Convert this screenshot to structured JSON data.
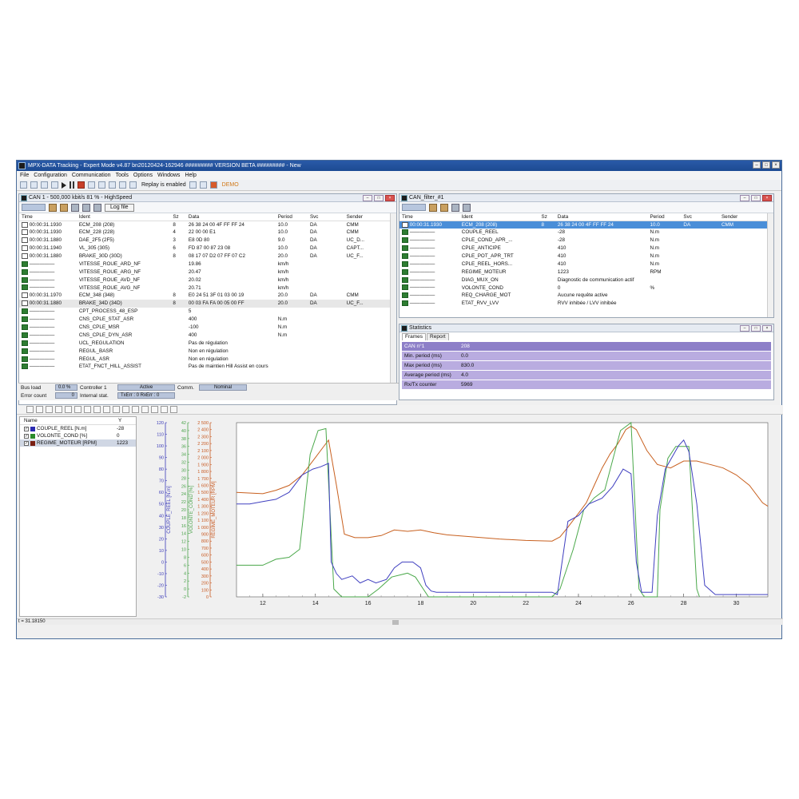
{
  "window": {
    "title": "MPX-DATA Tracking - Expert Mode v4.87 bn20120424-162946 ######### VERSION BETA ######### - New"
  },
  "menu": [
    "File",
    "Configuration",
    "Communication",
    "Tools",
    "Options",
    "Windows",
    "Help"
  ],
  "toolbar": {
    "replay_label": "Replay is enabled",
    "demo_label": "DEMO"
  },
  "can1": {
    "title": "CAN 1 - 500,000 kbit/s 81 % - HighSpeed",
    "log_button": "Log file",
    "columns": [
      "Time",
      "Ident",
      "Sz",
      "Data",
      "Period",
      "Svc",
      "Sender"
    ],
    "rows": [
      {
        "icon": "t",
        "time": "00:00:31.1930",
        "ident": "ECM_208 (208)",
        "sz": "8",
        "data": "26 38 24 00 4F FF FF 24",
        "period": "10.0",
        "svc": "DA",
        "sender": "CMM"
      },
      {
        "icon": "t",
        "time": "00:00:31.1930",
        "ident": "ECM_228 (228)",
        "sz": "4",
        "data": "22 00 00 E1",
        "period": "10.0",
        "svc": "DA",
        "sender": "CMM"
      },
      {
        "icon": "t",
        "time": "00:00:31.1880",
        "ident": "DAE_2F5 (2F5)",
        "sz": "3",
        "data": "E8 0D 80",
        "period": "9.0",
        "svc": "DA",
        "sender": "UC_D..."
      },
      {
        "icon": "t",
        "time": "00:00:31.1940",
        "ident": "VL_305 (305)",
        "sz": "6",
        "data": "FD 87 00 87 23 08",
        "period": "10.0",
        "svc": "DA",
        "sender": "CAPT..."
      },
      {
        "icon": "t",
        "time": "00:00:31.1880",
        "ident": "BRAKE_30D (30D)",
        "sz": "8",
        "data": "08 17 07 D2 07 FF 07 C2",
        "period": "20.0",
        "svc": "DA",
        "sender": "UC_F..."
      },
      {
        "icon": "g",
        "time": "—————",
        "ident": "VITESSE_ROUE_ARD_NF",
        "sz": "",
        "data": "19.86",
        "period": "km/h",
        "svc": "",
        "sender": ""
      },
      {
        "icon": "g",
        "time": "—————",
        "ident": "VITESSE_ROUE_ARG_NF",
        "sz": "",
        "data": "20.47",
        "period": "km/h",
        "svc": "",
        "sender": ""
      },
      {
        "icon": "g",
        "time": "—————",
        "ident": "VITESSE_ROUE_AVD_NF",
        "sz": "",
        "data": "20.02",
        "period": "km/h",
        "svc": "",
        "sender": ""
      },
      {
        "icon": "g",
        "time": "—————",
        "ident": "VITESSE_ROUE_AVG_NF",
        "sz": "",
        "data": "20.71",
        "period": "km/h",
        "svc": "",
        "sender": ""
      },
      {
        "icon": "t",
        "time": "00:00:31.1970",
        "ident": "ECM_348 (348)",
        "sz": "8",
        "data": "E0 24 51 3F 01 03 00 19",
        "period": "20.0",
        "svc": "DA",
        "sender": "CMM"
      },
      {
        "icon": "t",
        "time": "00:00:31.1880",
        "ident": "BRAKE_34D (34D)",
        "sz": "8",
        "data": "00 03 FA FA 00 05 00 FF",
        "period": "20.0",
        "svc": "DA",
        "sender": "UC_F...",
        "grey": true
      },
      {
        "icon": "g",
        "time": "—————",
        "ident": "CPT_PROCESS_48_ESP",
        "sz": "",
        "data": "5",
        "period": "",
        "svc": "",
        "sender": ""
      },
      {
        "icon": "g",
        "time": "—————",
        "ident": "CNS_CPLE_STAT_ASR",
        "sz": "",
        "data": "400",
        "period": "N.m",
        "svc": "",
        "sender": ""
      },
      {
        "icon": "g",
        "time": "—————",
        "ident": "CNS_CPLE_MSR",
        "sz": "",
        "data": "-100",
        "period": "N.m",
        "svc": "",
        "sender": ""
      },
      {
        "icon": "g",
        "time": "—————",
        "ident": "CNS_CPLE_DYN_ASR",
        "sz": "",
        "data": "400",
        "period": "N.m",
        "svc": "",
        "sender": ""
      },
      {
        "icon": "g",
        "time": "—————",
        "ident": "UCL_REGULATION",
        "sz": "",
        "data": "Pas de régulation",
        "period": "",
        "svc": "",
        "sender": ""
      },
      {
        "icon": "g",
        "time": "—————",
        "ident": "REGUL_BASR",
        "sz": "",
        "data": "Non en régulation",
        "period": "",
        "svc": "",
        "sender": ""
      },
      {
        "icon": "g",
        "time": "—————",
        "ident": "REGUL_ASR",
        "sz": "",
        "data": "Non en régulation",
        "period": "",
        "svc": "",
        "sender": ""
      },
      {
        "icon": "g",
        "time": "—————",
        "ident": "ETAT_FNCT_HILL_ASSIST",
        "sz": "",
        "data": "Pas de maintien Hill Assist en cours",
        "period": "",
        "svc": "",
        "sender": ""
      }
    ],
    "status": {
      "bus_load_label": "Bus load",
      "bus_load": "0.0 %",
      "controller_label": "Controller 1",
      "controller_state": "Active",
      "comm_label": "Comm.",
      "comm_state": "Nominal",
      "error_count_label": "Error count",
      "error_count": "0",
      "internal_label": "Internal stat.",
      "internal_state": "TxErr : 0 RxErr : 0"
    }
  },
  "filter": {
    "title": "CAN_filter_#1",
    "columns": [
      "Time",
      "Ident",
      "Sz",
      "Data",
      "Period",
      "Svc",
      "Sender"
    ],
    "rows": [
      {
        "icon": "t",
        "time": "00:00:31.1930",
        "ident": "ECM_208 (208)",
        "sz": "8",
        "data": "26 38 24 00 4F FF FF 24",
        "period": "10.0",
        "svc": "DA",
        "sender": "CMM",
        "sel": true
      },
      {
        "icon": "g",
        "time": "—————",
        "ident": "COUPLE_REEL",
        "sz": "",
        "data": "-28",
        "period": "N.m",
        "svc": "",
        "sender": ""
      },
      {
        "icon": "g",
        "time": "—————",
        "ident": "CPLE_COND_APR_...",
        "sz": "",
        "data": "-28",
        "period": "N.m",
        "svc": "",
        "sender": ""
      },
      {
        "icon": "g",
        "time": "—————",
        "ident": "CPLE_ANTICIPE",
        "sz": "",
        "data": "410",
        "period": "N.m",
        "svc": "",
        "sender": ""
      },
      {
        "icon": "g",
        "time": "—————",
        "ident": "CPLE_POT_APR_TRT",
        "sz": "",
        "data": "410",
        "period": "N.m",
        "svc": "",
        "sender": ""
      },
      {
        "icon": "g",
        "time": "—————",
        "ident": "CPLE_REEL_HORS...",
        "sz": "",
        "data": "410",
        "period": "N.m",
        "svc": "",
        "sender": ""
      },
      {
        "icon": "g",
        "time": "—————",
        "ident": "REGIME_MOTEUR",
        "sz": "",
        "data": "1223",
        "period": "RPM",
        "svc": "",
        "sender": ""
      },
      {
        "icon": "g",
        "time": "—————",
        "ident": "DIAG_MUX_ON",
        "sz": "",
        "data": "Diagnostic de communication actif",
        "period": "",
        "svc": "",
        "sender": ""
      },
      {
        "icon": "g",
        "time": "—————",
        "ident": "VOLONTE_COND",
        "sz": "",
        "data": "0",
        "period": "%",
        "svc": "",
        "sender": ""
      },
      {
        "icon": "g",
        "time": "—————",
        "ident": "REQ_CHARGE_MOT",
        "sz": "",
        "data": "Aucune requête active",
        "period": "",
        "svc": "",
        "sender": ""
      },
      {
        "icon": "g",
        "time": "—————",
        "ident": "ETAT_RVV_LVV",
        "sz": "",
        "data": "RVV inhibée / LVV inhibée",
        "period": "",
        "svc": "",
        "sender": ""
      }
    ]
  },
  "statistics": {
    "title": "Statistics",
    "tabs": [
      "Frames",
      "Report"
    ],
    "rows": [
      {
        "label": "CAN n°1",
        "value": "208"
      },
      {
        "label": "Min. period (ms)",
        "value": "0.0"
      },
      {
        "label": "Max period (ms)",
        "value": "830.0"
      },
      {
        "label": "Average period (ms)",
        "value": "4.0"
      },
      {
        "label": "Rx/Tx counter",
        "value": "5969"
      }
    ]
  },
  "legend": {
    "name_header": "Name",
    "y_header": "Y",
    "rows": [
      {
        "name": "COUPLE_REEL [N.m]",
        "value": "-28",
        "color": "#2a2ab0"
      },
      {
        "name": "VOLONTE_COND [%]",
        "value": "0",
        "color": "#2a8a2a"
      },
      {
        "name": "REGIME_MOTEUR [RPM]",
        "value": "1223",
        "color": "#7a1f12"
      }
    ]
  },
  "cursor_label": "t = 31.18150",
  "chart_data": {
    "type": "line",
    "xlim": [
      11,
      31.2
    ],
    "x_ticks": [
      "12",
      "14",
      "16",
      "18",
      "20",
      "22",
      "24",
      "26",
      "28",
      "30"
    ],
    "axes": [
      {
        "label": "COUPLE_REEL [N.m]",
        "color": "#3a3ab8",
        "ylim": [
          -30,
          120
        ],
        "ticks": [
          "120",
          "110",
          "100",
          "90",
          "80",
          "70",
          "60",
          "50",
          "40",
          "30",
          "20",
          "10",
          "0",
          "-10",
          "-20",
          "-30"
        ]
      },
      {
        "label": "VOLONTE_COND [%]",
        "color": "#4aa34a",
        "ylim": [
          -2,
          42
        ],
        "ticks": [
          "42",
          "40",
          "38",
          "36",
          "34",
          "32",
          "30",
          "28",
          "26",
          "24",
          "22",
          "20",
          "18",
          "16",
          "14",
          "12",
          "10",
          "8",
          "6",
          "4",
          "2",
          "0",
          "-2"
        ]
      },
      {
        "label": "REGIME_MOTEUR [RPM]",
        "color": "#c85a22",
        "ylim": [
          0,
          2500
        ],
        "ticks": [
          "2 500",
          "2 400",
          "2 300",
          "2 200",
          "2 100",
          "2 000",
          "1 900",
          "1 800",
          "1 700",
          "1 600",
          "1 500",
          "1 400",
          "1 300",
          "1 200",
          "1 100",
          "1 000",
          "900",
          "800",
          "700",
          "600",
          "500",
          "400",
          "300",
          "200",
          "100",
          "0"
        ]
      }
    ],
    "series": [
      {
        "name": "REGIME_MOTEUR [RPM]",
        "color": "#c8601f",
        "axis": 2,
        "points": [
          [
            11,
            1500
          ],
          [
            12,
            1480
          ],
          [
            12.5,
            1530
          ],
          [
            13,
            1600
          ],
          [
            13.5,
            1750
          ],
          [
            14,
            2000
          ],
          [
            14.3,
            2150
          ],
          [
            14.5,
            2250
          ],
          [
            14.8,
            1600
          ],
          [
            15.1,
            900
          ],
          [
            15.5,
            850
          ],
          [
            16,
            850
          ],
          [
            16.5,
            880
          ],
          [
            17,
            960
          ],
          [
            17.5,
            940
          ],
          [
            18,
            960
          ],
          [
            18.5,
            920
          ],
          [
            19,
            890
          ],
          [
            20,
            860
          ],
          [
            21,
            830
          ],
          [
            22,
            810
          ],
          [
            23,
            800
          ],
          [
            23.3,
            860
          ],
          [
            23.6,
            1000
          ],
          [
            24,
            1200
          ],
          [
            24.3,
            1350
          ],
          [
            24.6,
            1600
          ],
          [
            24.9,
            1850
          ],
          [
            25.2,
            2050
          ],
          [
            25.5,
            2200
          ],
          [
            25.8,
            2400
          ],
          [
            26,
            2450
          ],
          [
            26.2,
            2400
          ],
          [
            26.6,
            2100
          ],
          [
            27,
            1900
          ],
          [
            27.5,
            1850
          ],
          [
            28,
            1950
          ],
          [
            28.5,
            1950
          ],
          [
            29,
            1900
          ],
          [
            29.5,
            1850
          ],
          [
            30,
            1750
          ],
          [
            30.5,
            1600
          ],
          [
            31,
            1350
          ],
          [
            31.2,
            1300
          ]
        ]
      },
      {
        "name": "VOLONTE_COND [%]",
        "color": "#4aa84a",
        "axis": 1,
        "points": [
          [
            11,
            6
          ],
          [
            12,
            6
          ],
          [
            12.5,
            7.5
          ],
          [
            13,
            8
          ],
          [
            13.4,
            10
          ],
          [
            13.8,
            34
          ],
          [
            14.1,
            40
          ],
          [
            14.4,
            40.5
          ],
          [
            14.7,
            0
          ],
          [
            15,
            -2
          ],
          [
            16,
            -2
          ],
          [
            16.4,
            0
          ],
          [
            16.9,
            3
          ],
          [
            17.5,
            4
          ],
          [
            17.8,
            3
          ],
          [
            18.1,
            0
          ],
          [
            18.3,
            -2
          ],
          [
            23,
            -2
          ],
          [
            23.3,
            0
          ],
          [
            23.8,
            10
          ],
          [
            24.2,
            20
          ],
          [
            24.6,
            23
          ],
          [
            25,
            25
          ],
          [
            25.6,
            40
          ],
          [
            26,
            42
          ],
          [
            26.3,
            0
          ],
          [
            26.5,
            -2
          ],
          [
            27,
            -2
          ],
          [
            27.1,
            20
          ],
          [
            27.4,
            33
          ],
          [
            27.7,
            36
          ],
          [
            28.2,
            36
          ],
          [
            28.5,
            0
          ],
          [
            28.6,
            -2
          ]
        ]
      },
      {
        "name": "COUPLE_REEL [N.m]",
        "color": "#4040c0",
        "axis": 0,
        "points": [
          [
            11,
            50
          ],
          [
            11.5,
            50
          ],
          [
            12,
            52
          ],
          [
            12.5,
            54
          ],
          [
            13,
            60
          ],
          [
            13.5,
            75
          ],
          [
            13.9,
            80
          ],
          [
            14.2,
            82
          ],
          [
            14.5,
            85
          ],
          [
            14.6,
            0
          ],
          [
            14.8,
            -10
          ],
          [
            15,
            -15
          ],
          [
            15.4,
            -12
          ],
          [
            15.7,
            -18
          ],
          [
            16,
            -15
          ],
          [
            16.3,
            -18
          ],
          [
            16.7,
            -15
          ],
          [
            17,
            -5
          ],
          [
            17.3,
            0
          ],
          [
            17.7,
            0
          ],
          [
            18,
            -5
          ],
          [
            18.2,
            -20
          ],
          [
            18.4,
            -25
          ],
          [
            18.6,
            -26
          ],
          [
            21,
            -26
          ],
          [
            22,
            -26
          ],
          [
            23,
            -26
          ],
          [
            23.2,
            -28
          ],
          [
            23.6,
            35
          ],
          [
            24,
            40
          ],
          [
            24.4,
            50
          ],
          [
            24.9,
            55
          ],
          [
            25.3,
            65
          ],
          [
            25.7,
            80
          ],
          [
            26,
            76
          ],
          [
            26.2,
            0
          ],
          [
            26.4,
            -26
          ],
          [
            26.8,
            -26
          ],
          [
            27,
            40
          ],
          [
            27.3,
            80
          ],
          [
            27.6,
            92
          ],
          [
            27.8,
            100
          ],
          [
            28,
            105
          ],
          [
            28.2,
            95
          ],
          [
            28.5,
            50
          ],
          [
            28.8,
            -20
          ],
          [
            29.2,
            -28
          ],
          [
            31.2,
            -28
          ]
        ]
      }
    ]
  }
}
